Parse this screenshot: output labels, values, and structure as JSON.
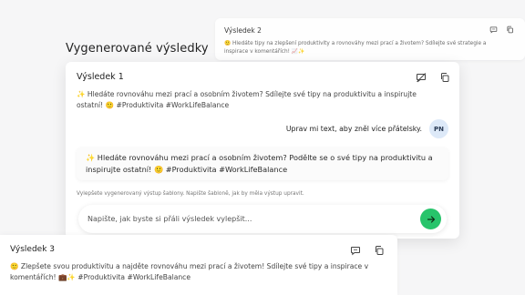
{
  "heading": "Vygenerované výsledky",
  "result2": {
    "title": "Výsledek 2",
    "text": "🙂 Hledáte tipy na zlepšení produktivity a rovnováhy mezi prací a životem? Sdílejte své strategie a inspirace v komentářích! 📈✨"
  },
  "result1": {
    "title": "Výsledek 1",
    "text": "✨ Hledáte rovnováhu mezi prací a osobním životem? Sdílejte své tipy na produktivitu a inspirujte ostatní! 🙂 #Produktivita #WorkLifeBalance",
    "user_message": "Uprav mi text, aby zněl více přátelsky.",
    "avatar_initials": "PN",
    "ai_reply": "✨ Hledáte rovnováhu mezi prací a osobním životem? Podělte se o své tipy na produktivitu a inspirujte ostatní! 🙂 #Produktivita #WorkLifeBalance",
    "hint": "Vylepšete vygenerovaný výstup šablony. Napište šabloně, jak by měla výstup upravit.",
    "input_placeholder": "Napište, jak byste si přáli výsledek vylepšit..."
  },
  "result3": {
    "title": "Výsledek 3",
    "text": "🙂 Zlepšete svou produktivitu a najděte rovnováhu mezi prací a životem! Sdílejte své tipy a inspirace v komentářích! 💼✨ #Produktivita #WorkLifeBalance"
  },
  "icons": {
    "refine": "chat-bubble-icon",
    "refine_off": "chat-bubble-off-icon",
    "copy": "copy-icon",
    "send": "arrow-right-icon"
  },
  "colors": {
    "send_button": "#27c46b",
    "avatar_bg": "#dde9f8"
  }
}
